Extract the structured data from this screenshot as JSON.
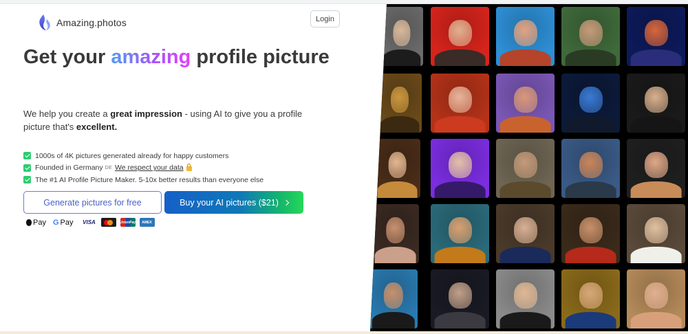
{
  "header": {
    "brand_name": "Amazing.photos",
    "logo_icon": "flame-logo-icon",
    "login_label": "Login"
  },
  "hero": {
    "title_pre": "Get your ",
    "title_highlight": "amazing",
    "title_post": " profile picture",
    "sub_1": "We help you create a ",
    "sub_bold_1": "great impression",
    "sub_2": " - using AI to give you a profile picture that's ",
    "sub_bold_2": "excellent."
  },
  "features": {
    "item_1": "1000s of 4K pictures generated already for happy customers",
    "item_2_pre": "Founded in Germany",
    "item_2_flag": "DE",
    "item_2_link": "We respect your data",
    "item_3": "The #1 AI Profile Picture Maker. 5-10x better results than everyone else"
  },
  "cta": {
    "free_label": "Generate pictures for free",
    "buy_label": "Buy your AI pictures ($21)"
  },
  "payments": {
    "apple_pay": "Pay",
    "google_pay": "Pay",
    "google_g": "G",
    "visa": "VISA",
    "unionpay": "UnionPay",
    "amex": "AMEX"
  },
  "colors": {
    "accent_gradient_start": "#4f9bf5",
    "accent_gradient_end": "#e040fb",
    "buy_gradient_start": "#1560c8",
    "buy_gradient_end": "#26d85a",
    "check_green": "#2ecc71"
  }
}
